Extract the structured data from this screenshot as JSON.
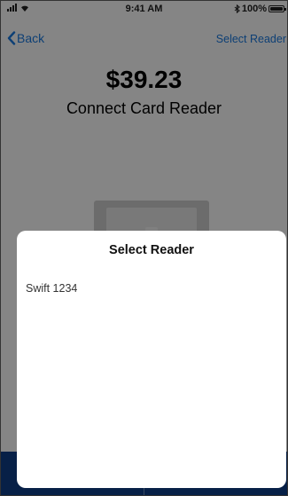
{
  "status_bar": {
    "time": "9:41 AM",
    "battery": "100%"
  },
  "nav": {
    "back_label": "Back",
    "right_label": "Select Reader"
  },
  "main": {
    "amount": "$39.23",
    "subtitle": "Connect Card Reader"
  },
  "sheet": {
    "title": "Select Reader",
    "readers": [
      "Swift 1234"
    ]
  },
  "colors": {
    "accent": "#1a7ae0",
    "bottom_bar": "#0e3f88"
  }
}
